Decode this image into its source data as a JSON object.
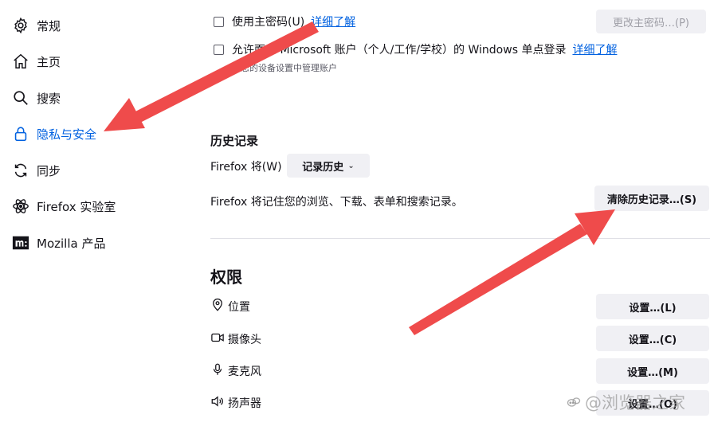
{
  "sidebar": {
    "items": [
      {
        "label": "常规",
        "icon": "gear-icon"
      },
      {
        "label": "主页",
        "icon": "home-icon"
      },
      {
        "label": "搜索",
        "icon": "search-icon"
      },
      {
        "label": "隐私与安全",
        "icon": "lock-icon",
        "active": true
      },
      {
        "label": "同步",
        "icon": "sync-icon"
      },
      {
        "label": "Firefox 实验室",
        "icon": "labs-icon"
      },
      {
        "label": "Mozilla 产品",
        "icon": "mozilla-icon"
      }
    ]
  },
  "passwords": {
    "primary_password_label": "使用主密码(U)",
    "primary_learn_more": "详细了解",
    "change_primary_button": "更改主密码…(P)",
    "sso_label": "允许面向 Microsoft 账户（个人/工作/学校）的 Windows 单点登录",
    "sso_learn_more": "详细了解",
    "sso_note": "在您的设备设置中管理账户"
  },
  "history": {
    "heading": "历史记录",
    "firefox_will_label": "Firefox 将(W)",
    "mode_select": "记录历史",
    "description": "Firefox 将记住您的浏览、下载、表单和搜索记录。",
    "clear_button": "清除历史记录…(S)"
  },
  "permissions": {
    "heading": "权限",
    "items": [
      {
        "label": "位置",
        "icon": "location-pin-icon",
        "button": "设置…(L)"
      },
      {
        "label": "摄像头",
        "icon": "camera-icon",
        "button": "设置…(C)"
      },
      {
        "label": "麦克风",
        "icon": "microphone-icon",
        "button": "设置…(M)"
      },
      {
        "label": "扬声器",
        "icon": "speaker-icon",
        "button": "设置…(O)"
      }
    ]
  },
  "colors": {
    "accent": "#0061e0",
    "annotation_arrow": "#ef4b4b"
  },
  "watermark": "@浏览器之家"
}
